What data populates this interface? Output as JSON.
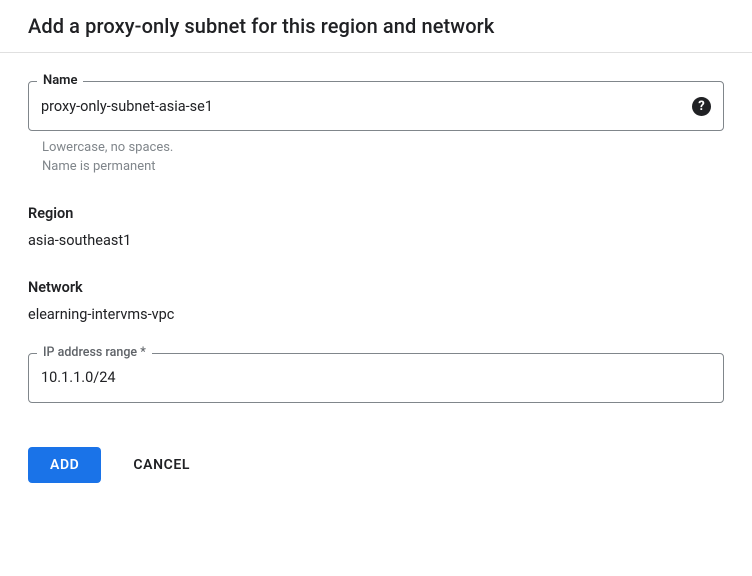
{
  "header": {
    "title": "Add a proxy-only subnet for this region and network"
  },
  "name_field": {
    "label": "Name",
    "value": "proxy-only-subnet-asia-se1",
    "helper_line1": "Lowercase, no spaces.",
    "helper_line2": "Name is permanent"
  },
  "region": {
    "label": "Region",
    "value": "asia-southeast1"
  },
  "network": {
    "label": "Network",
    "value": "elearning-intervms-vpc"
  },
  "ip_range": {
    "label": "IP address range *",
    "value": "10.1.1.0/24"
  },
  "actions": {
    "add_label": "ADD",
    "cancel_label": "CANCEL"
  }
}
